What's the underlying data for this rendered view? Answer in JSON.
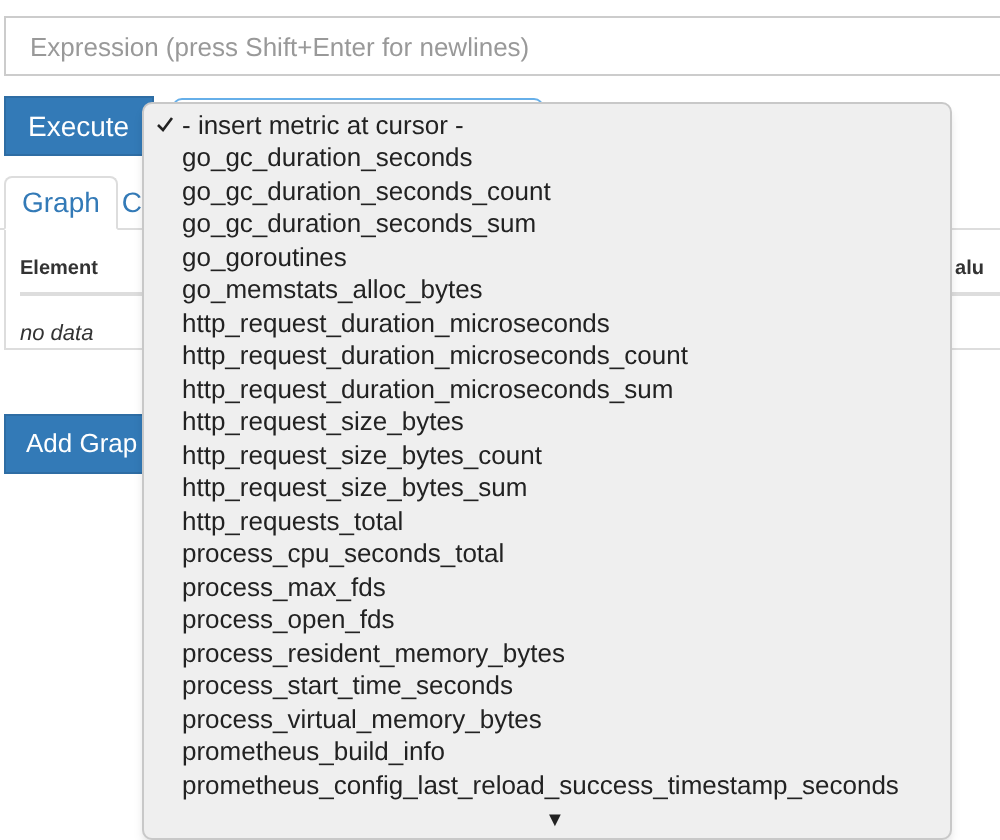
{
  "expression": {
    "placeholder": "Expression (press Shift+Enter for newlines)"
  },
  "execute_button": "Execute",
  "tabs": [
    {
      "label": "Graph",
      "selected": true
    },
    {
      "label": "C",
      "selected": false
    }
  ],
  "table": {
    "columns": [
      "Element",
      "alu"
    ],
    "empty_text": "no data"
  },
  "add_graph_button": "Add Grap",
  "metric_menu": {
    "items": [
      {
        "label": "- insert metric at cursor -",
        "selected": true
      },
      {
        "label": "go_gc_duration_seconds",
        "selected": false
      },
      {
        "label": "go_gc_duration_seconds_count",
        "selected": false
      },
      {
        "label": "go_gc_duration_seconds_sum",
        "selected": false
      },
      {
        "label": "go_goroutines",
        "selected": false
      },
      {
        "label": "go_memstats_alloc_bytes",
        "selected": false
      },
      {
        "label": "http_request_duration_microseconds",
        "selected": false
      },
      {
        "label": "http_request_duration_microseconds_count",
        "selected": false
      },
      {
        "label": "http_request_duration_microseconds_sum",
        "selected": false
      },
      {
        "label": "http_request_size_bytes",
        "selected": false
      },
      {
        "label": "http_request_size_bytes_count",
        "selected": false
      },
      {
        "label": "http_request_size_bytes_sum",
        "selected": false
      },
      {
        "label": "http_requests_total",
        "selected": false
      },
      {
        "label": "process_cpu_seconds_total",
        "selected": false
      },
      {
        "label": "process_max_fds",
        "selected": false
      },
      {
        "label": "process_open_fds",
        "selected": false
      },
      {
        "label": "process_resident_memory_bytes",
        "selected": false
      },
      {
        "label": "process_start_time_seconds",
        "selected": false
      },
      {
        "label": "process_virtual_memory_bytes",
        "selected": false
      },
      {
        "label": "prometheus_build_info",
        "selected": false
      },
      {
        "label": "prometheus_config_last_reload_success_timestamp_seconds",
        "selected": false
      }
    ],
    "scroll_arrow": "▼"
  }
}
